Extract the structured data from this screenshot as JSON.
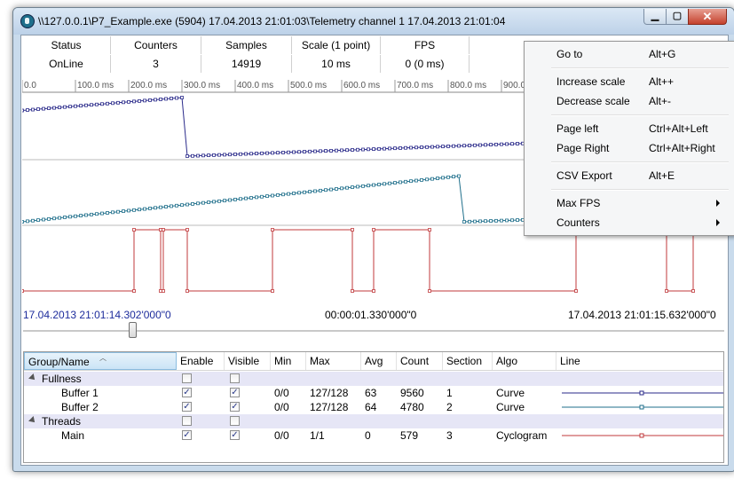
{
  "window": {
    "title": "\\\\127.0.0.1\\P7_Example.exe (5904) 17.04.2013 21:01:03\\Telemetry channel 1 17.04.2013 21:01:04",
    "min_glyph": "▁",
    "max_glyph": "▢",
    "close_glyph": "✕"
  },
  "status": {
    "headers": [
      "Status",
      "Counters",
      "Samples",
      "Scale (1 point)",
      "FPS"
    ],
    "values": [
      "OnLine",
      "3",
      "14919",
      "10 ms",
      "0 (0 ms)"
    ]
  },
  "chart_data": {
    "type": "line",
    "x_ticks": [
      "0.0",
      "100.0 ms",
      "200.0 ms",
      "300.0 ms",
      "400.0 ms",
      "500.0 ms",
      "600.0 ms",
      "700.0 ms",
      "800.0 ms",
      "900.0"
    ],
    "x_unit": "ms",
    "xlim": [
      0,
      1330
    ],
    "series": [
      {
        "name": "Buffer 1",
        "color": "#2a2a8a",
        "points": [
          [
            0,
            0.78
          ],
          [
            300,
            1.0
          ],
          [
            310,
            0.0
          ],
          [
            1330,
            0.35
          ]
        ]
      },
      {
        "name": "Buffer 2",
        "color": "#1f6f8b",
        "points": [
          [
            0,
            0.0
          ],
          [
            820,
            0.78
          ],
          [
            830,
            0.0
          ],
          [
            1000,
            0.05
          ]
        ]
      },
      {
        "name": "Main",
        "color": "#c0393b",
        "segments": [
          [
            0,
            0
          ],
          [
            210,
            1
          ],
          [
            260,
            0
          ],
          [
            265,
            1
          ],
          [
            310,
            0
          ],
          [
            470,
            1
          ],
          [
            620,
            0
          ],
          [
            660,
            1
          ],
          [
            765,
            0
          ],
          [
            1040,
            1
          ],
          [
            1210,
            0
          ],
          [
            1260,
            1
          ]
        ]
      }
    ]
  },
  "timeline": {
    "start": "17.04.2013 21:01:14.302'000\"0",
    "duration": "00:00:01.330'000\"0",
    "end": "17.04.2013 21:01:15.632'000\"0",
    "slider_position": 0.15
  },
  "grid": {
    "headers": [
      "Group/Name",
      "Enable",
      "Visible",
      "Min",
      "Max",
      "Avg",
      "Count",
      "Section",
      "Algo",
      "Line"
    ],
    "rows": [
      {
        "kind": "group",
        "name": "Fullness",
        "enable": false,
        "visible": false
      },
      {
        "kind": "item",
        "name": "Buffer 1",
        "enable": true,
        "visible": true,
        "min": "0/0",
        "max": "127/128",
        "avg": "63",
        "count": "9560",
        "section": "1",
        "algo": "Curve",
        "line_color": "#2a2a8a"
      },
      {
        "kind": "item",
        "name": "Buffer 2",
        "enable": true,
        "visible": true,
        "min": "0/0",
        "max": "127/128",
        "avg": "64",
        "count": "4780",
        "section": "2",
        "algo": "Curve",
        "line_color": "#1f6f8b"
      },
      {
        "kind": "group",
        "name": "Threads",
        "enable": false,
        "visible": false
      },
      {
        "kind": "item",
        "name": "Main",
        "enable": true,
        "visible": true,
        "min": "0/0",
        "max": "1/1",
        "avg": "0",
        "count": "579",
        "section": "3",
        "algo": "Cyclogram",
        "line_color": "#c0393b"
      }
    ]
  },
  "context_menu": {
    "items": [
      {
        "label": "Go to",
        "shortcut": "Alt+G"
      },
      {
        "separator": true
      },
      {
        "label": "Increase scale",
        "shortcut": "Alt++"
      },
      {
        "label": "Decrease scale",
        "shortcut": "Alt+-"
      },
      {
        "separator": true
      },
      {
        "label": "Page left",
        "shortcut": "Ctrl+Alt+Left"
      },
      {
        "label": "Page Right",
        "shortcut": "Ctrl+Alt+Right"
      },
      {
        "separator": true
      },
      {
        "label": "CSV Export",
        "shortcut": "Alt+E"
      },
      {
        "separator": true
      },
      {
        "label": "Max FPS",
        "submenu": true
      },
      {
        "label": "Counters",
        "submenu": true
      }
    ]
  }
}
